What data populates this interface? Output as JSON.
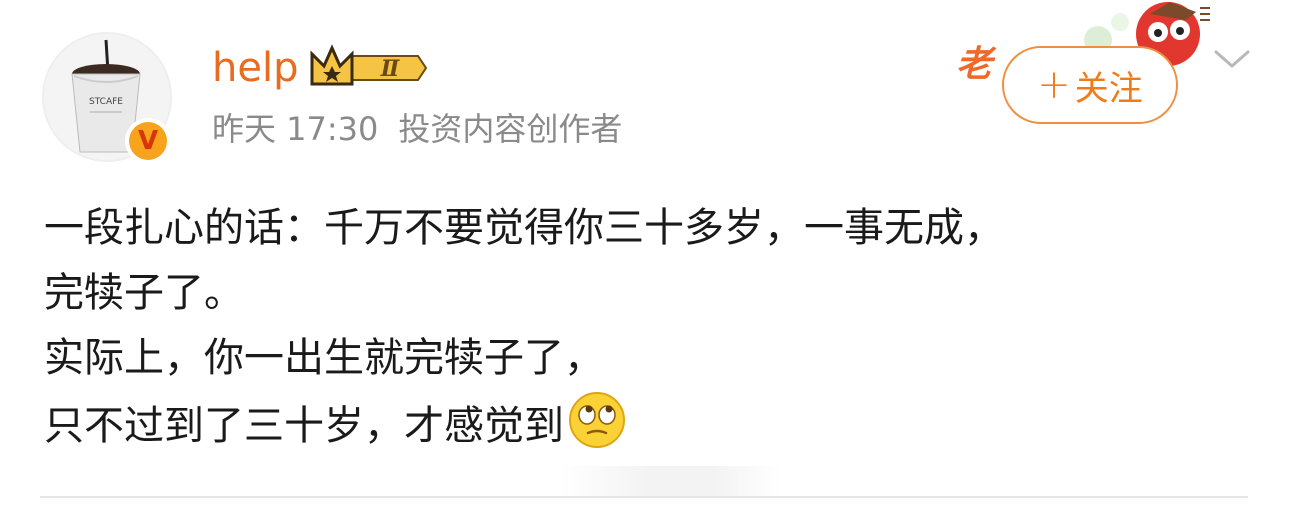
{
  "user": {
    "name": "help",
    "level": "Ⅱ",
    "time": "昨天 17:30",
    "title": "投资内容创作者",
    "avatar_label": "STCAFE",
    "verified_mark": "V"
  },
  "follow_button": {
    "plus": "+",
    "label": "关注"
  },
  "post": {
    "lines": [
      "一段扎心的话：千万不要觉得你三十多岁，一事无成，",
      "完犊子了。",
      "实际上，你一出生就完犊子了，",
      "只不过到了三十岁，才感觉到"
    ],
    "emoji": "eye-roll-emoji"
  },
  "decoration": {
    "text": "老"
  },
  "colors": {
    "username": "#e86b1f",
    "follow": "#ef7c1b",
    "meta": "#8a8a8a",
    "text": "#1a1a1a",
    "badge": "#f7a31c"
  }
}
